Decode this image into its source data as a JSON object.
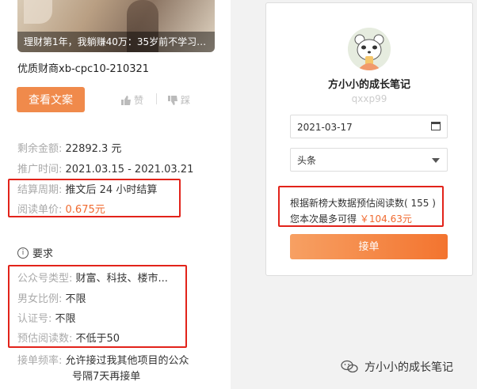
{
  "banner": {
    "caption": "理财第1年，我躺赚40万：35岁前不学习…"
  },
  "product": {
    "name": "优质财商xb-cpc10-210321"
  },
  "actions": {
    "view_label": "查看文案",
    "like_label": "赞",
    "dislike_label": "踩"
  },
  "info": {
    "balance_label": "剩余金额:",
    "balance_value": "22892.3 元",
    "period_label": "推广时间:",
    "period_value": "2021.03.15 - 2021.03.21",
    "settle_label": "结算周期:",
    "settle_value": "推文后 24 小时结算",
    "price_label": "阅读单价:",
    "price_value": "0.675元"
  },
  "requirements": {
    "title": "要求",
    "type_label": "公众号类型:",
    "type_value": "财富、科技、楼市...",
    "gender_label": "男女比例:",
    "gender_value": "不限",
    "cert_label": "认证号:",
    "cert_value": "不限",
    "reads_label": "预估阅读数:",
    "reads_value": "不低于50",
    "freq_label": "接单频率:",
    "freq_value_1": "允许接过我其他项目的公众",
    "freq_value_2": "号隔7天再接单"
  },
  "account": {
    "name": "方小小的成长笔记",
    "id": "qxxp99",
    "date_value": "2021-03-17",
    "position_value": "头条",
    "estimate_line": "根据新榜大数据预估阅读数( 155 )",
    "earn_prefix": "您本次最多可得",
    "earn_value": "￥104.63元",
    "submit_label": "接单"
  },
  "watermark": {
    "text": "方小小的成长笔记"
  },
  "colors": {
    "accent": "#f08a4b",
    "highlight": "#e2231a",
    "price": "#f06a2f"
  }
}
